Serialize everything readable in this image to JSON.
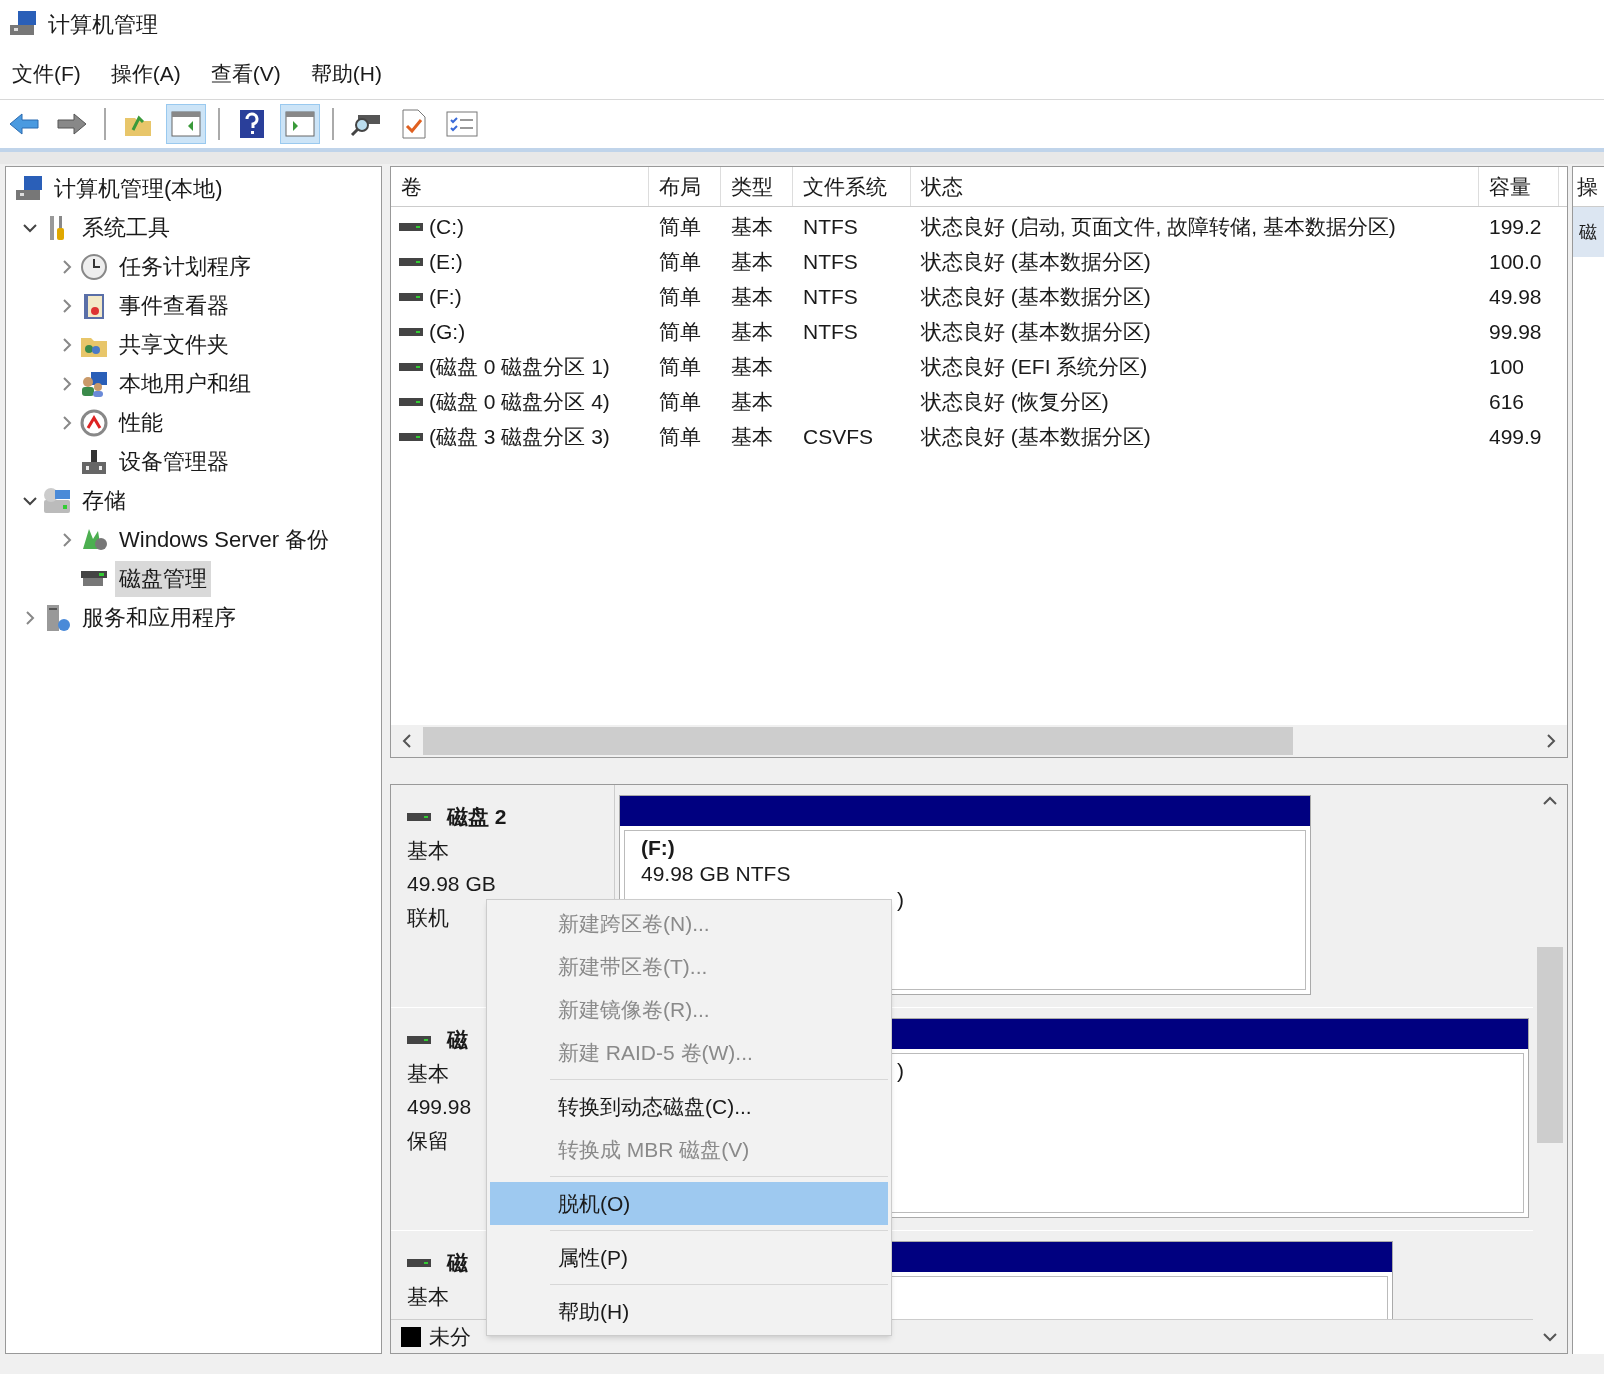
{
  "window": {
    "title": "计算机管理"
  },
  "menu_bar": [
    "文件(F)",
    "操作(A)",
    "查看(V)",
    "帮助(H)"
  ],
  "toolbar": [
    {
      "kind": "back",
      "pressed": false
    },
    {
      "kind": "forward",
      "pressed": false
    },
    {
      "kind": "separator"
    },
    {
      "kind": "up",
      "pressed": false
    },
    {
      "kind": "tree",
      "pressed": true
    },
    {
      "kind": "separator"
    },
    {
      "kind": "help",
      "pressed": false
    },
    {
      "kind": "pane",
      "pressed": true
    },
    {
      "kind": "separator"
    },
    {
      "kind": "connect",
      "pressed": false
    },
    {
      "kind": "check",
      "pressed": false
    },
    {
      "kind": "list",
      "pressed": false
    }
  ],
  "tree": [
    {
      "label": "计算机管理(本地)",
      "kind": "computer",
      "selected": false,
      "children": [
        {
          "label": "系统工具",
          "kind": "tools",
          "expanded": true,
          "selected": false,
          "children": [
            {
              "label": "任务计划程序",
              "kind": "clock",
              "expanded": false,
              "selected": false
            },
            {
              "label": "事件查看器",
              "kind": "log",
              "expanded": false,
              "selected": false
            },
            {
              "label": "共享文件夹",
              "kind": "folder",
              "expanded": false,
              "selected": false
            },
            {
              "label": "本地用户和组",
              "kind": "users",
              "expanded": false,
              "selected": false
            },
            {
              "label": "性能",
              "kind": "gauge",
              "expanded": false,
              "selected": false
            },
            {
              "label": "设备管理器",
              "kind": "device",
              "selected": false
            }
          ]
        },
        {
          "label": "存储",
          "kind": "storage",
          "expanded": true,
          "selected": false,
          "children": [
            {
              "label": "Windows Server 备份",
              "kind": "backup",
              "expanded": false,
              "selected": false
            },
            {
              "label": "磁盘管理",
              "kind": "disk",
              "selected": true
            }
          ]
        },
        {
          "label": "服务和应用程序",
          "kind": "server",
          "expanded": false,
          "selected": false
        }
      ]
    }
  ],
  "volume_table": {
    "columns": [
      "卷",
      "布局",
      "类型",
      "文件系统",
      "状态",
      "容量"
    ],
    "rows": [
      {
        "volume": "(C:)",
        "layout": "简单",
        "type": "基本",
        "file_system": "NTFS",
        "status": "状态良好 (启动, 页面文件, 故障转储, 基本数据分区)",
        "capacity": "199.2"
      },
      {
        "volume": "(E:)",
        "layout": "简单",
        "type": "基本",
        "file_system": "NTFS",
        "status": "状态良好 (基本数据分区)",
        "capacity": "100.0"
      },
      {
        "volume": "(F:)",
        "layout": "简单",
        "type": "基本",
        "file_system": "NTFS",
        "status": "状态良好 (基本数据分区)",
        "capacity": "49.98"
      },
      {
        "volume": "(G:)",
        "layout": "简单",
        "type": "基本",
        "file_system": "NTFS",
        "status": "状态良好 (基本数据分区)",
        "capacity": "99.98"
      },
      {
        "volume": "(磁盘 0 磁盘分区 1)",
        "layout": "简单",
        "type": "基本",
        "status": "状态良好 (EFI 系统分区)",
        "capacity": "100"
      },
      {
        "volume": "(磁盘 0 磁盘分区 4)",
        "layout": "简单",
        "type": "基本",
        "status": "状态良好 (恢复分区)",
        "capacity": "616"
      },
      {
        "volume": "(磁盘 3 磁盘分区 3)",
        "layout": "简单",
        "type": "基本",
        "file_system": "CSVFS",
        "status": "状态良好 (基本数据分区)",
        "capacity": "499.9"
      }
    ]
  },
  "disks": [
    {
      "name": "磁盘 2",
      "type": "基本",
      "size": "49.98 GB",
      "status": "联机",
      "partitions": [
        {
          "name": "(F:)",
          "detail": "49.98 GB NTFS",
          "status": ")"
        }
      ]
    },
    {
      "name": "磁",
      "type": "基本",
      "size": "499.98",
      "status": "保留",
      "partitions": [
        {
          "status": ")"
        }
      ]
    },
    {
      "name": "磁",
      "type": "基本"
    }
  ],
  "legend": [
    {
      "label": "未分",
      "color": "#000000"
    }
  ],
  "actions_pane": {
    "header": "操",
    "item": "磁"
  },
  "context_menu": [
    {
      "kind": "item",
      "label": "新建跨区卷(N)...",
      "disabled": true,
      "selected": false
    },
    {
      "kind": "item",
      "label": "新建带区卷(T)...",
      "disabled": true,
      "selected": false
    },
    {
      "kind": "item",
      "label": "新建镜像卷(R)...",
      "disabled": true,
      "selected": false
    },
    {
      "kind": "item",
      "label": "新建 RAID-5 卷(W)...",
      "disabled": true,
      "selected": false
    },
    {
      "kind": "separator"
    },
    {
      "kind": "item",
      "label": "转换到动态磁盘(C)...",
      "disabled": false,
      "selected": false
    },
    {
      "kind": "item",
      "label": "转换成 MBR 磁盘(V)",
      "disabled": true,
      "selected": false
    },
    {
      "kind": "separator"
    },
    {
      "kind": "item",
      "label": "脱机(O)",
      "disabled": false,
      "selected": true
    },
    {
      "kind": "separator"
    },
    {
      "kind": "item",
      "label": "属性(P)",
      "disabled": false,
      "selected": false
    },
    {
      "kind": "separator"
    },
    {
      "kind": "item",
      "label": "帮助(H)",
      "disabled": false,
      "selected": false
    }
  ]
}
